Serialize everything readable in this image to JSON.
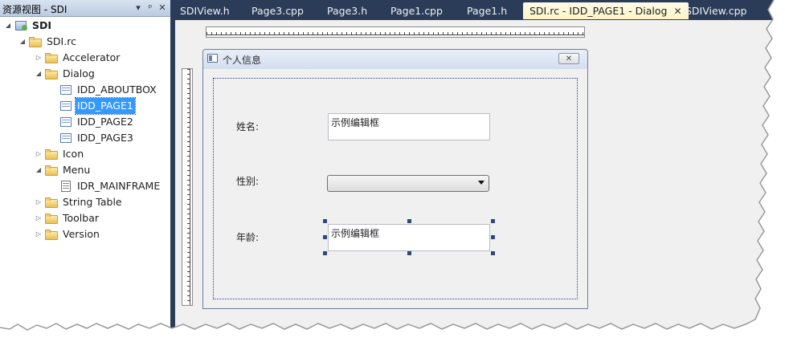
{
  "resource_view": {
    "title": "资源视图 - SDI",
    "pin_label": "ᵖ",
    "close_label": "✕",
    "dropdown_label": "▾"
  },
  "tree": {
    "root": "SDI",
    "rc": "SDI.rc",
    "accelerator": "Accelerator",
    "dialog": "Dialog",
    "dialogs": [
      "IDD_ABOUTBOX",
      "IDD_PAGE1",
      "IDD_PAGE2",
      "IDD_PAGE3"
    ],
    "icon": "Icon",
    "menu": "Menu",
    "menus": [
      "IDR_MAINFRAME"
    ],
    "string_table": "String Table",
    "toolbar": "Toolbar",
    "version": "Version"
  },
  "tabs": [
    "SDIView.h",
    "Page3.cpp",
    "Page3.h",
    "Page1.cpp",
    "Page1.h",
    "SDI.rc - IDD_PAGE1 - Dialog",
    "SDIView.cpp"
  ],
  "active_tab_close": "✕",
  "dialog": {
    "title": "个人信息",
    "close_glyph": "✕",
    "name_label": "姓名:",
    "name_value": "示例编辑框",
    "gender_label": "性别:",
    "age_label": "年龄:",
    "age_value": "示例编辑框"
  },
  "colors": {
    "accent_selected": "#3399ff",
    "tab_bar": "#2b3c59",
    "active_tab": "#fdf4c6"
  }
}
